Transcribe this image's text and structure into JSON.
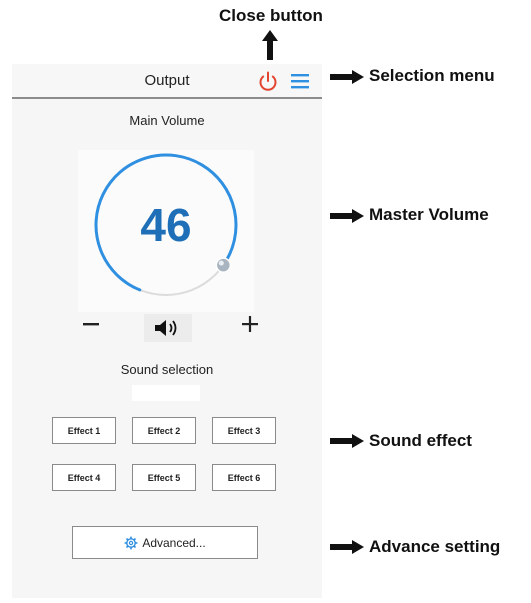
{
  "annotations": {
    "close_button": "Close button",
    "selection_menu": "Selection menu",
    "master_volume": "Master Volume",
    "sound_effect": "Sound effect",
    "advance_setting": "Advance setting"
  },
  "app": {
    "title": "Output",
    "main_volume_label": "Main Volume",
    "volume": 46,
    "volume_text": "46",
    "sound_selection_label": "Sound selection",
    "sound_selection_value": "",
    "effects": [
      "Effect 1",
      "Effect 2",
      "Effect 3",
      "Effect 4",
      "Effect 5",
      "Effect 6"
    ],
    "advanced_label": "Advanced...",
    "icons": {
      "close": "power-icon",
      "menu": "hamburger-menu-icon",
      "decrease": "minus-icon",
      "speaker": "speaker-icon",
      "increase": "plus-icon",
      "advanced": "gear-icon"
    }
  },
  "colors": {
    "accent": "#2f8fe0",
    "volume_text": "#1f6fb8",
    "power": "#e2452f",
    "background": "#f6f6f6"
  }
}
